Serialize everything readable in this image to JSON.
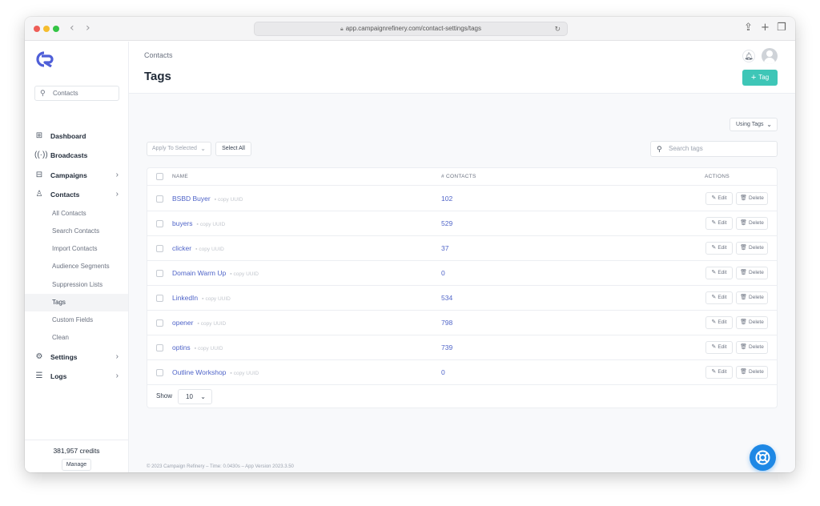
{
  "browser": {
    "url": "app.campaignrefinery.com/contact-settings/tags"
  },
  "sidebar": {
    "search_placeholder": "Contacts",
    "items": [
      {
        "label": "Dashboard",
        "icon": "grid-icon"
      },
      {
        "label": "Broadcasts",
        "icon": "broadcast-icon"
      },
      {
        "label": "Campaigns",
        "icon": "inbox-icon"
      },
      {
        "label": "Contacts",
        "icon": "user-icon"
      }
    ],
    "contacts_sub": [
      "All Contacts",
      "Search Contacts",
      "Import Contacts",
      "Audience Segments",
      "Suppression Lists",
      "Tags",
      "Custom Fields",
      "Clean"
    ],
    "active_sub": "Tags",
    "bottom_items": [
      {
        "label": "Settings",
        "icon": "gear-icon"
      },
      {
        "label": "Logs",
        "icon": "list-icon"
      }
    ],
    "credits": "381,957 credits",
    "manage_label": "Manage"
  },
  "header": {
    "breadcrumb": "Contacts",
    "title": "Tags",
    "add_tag_label": "Tag"
  },
  "toolbar": {
    "using_tags": "Using Tags",
    "apply_to_selected": "Apply To Selected",
    "select_all": "Select All",
    "search_placeholder": "Search tags"
  },
  "table": {
    "columns": [
      "NAME",
      "# CONTACTS",
      "ACTIONS"
    ],
    "copy_uuid_label": "copy UUID",
    "edit_label": "Edit",
    "delete_label": "Delete",
    "rows": [
      {
        "name": "BSBD Buyer",
        "count": "102"
      },
      {
        "name": "buyers",
        "count": "529"
      },
      {
        "name": "clicker",
        "count": "37"
      },
      {
        "name": "Domain Warm Up",
        "count": "0"
      },
      {
        "name": "LinkedIn",
        "count": "534"
      },
      {
        "name": "opener",
        "count": "798"
      },
      {
        "name": "optins",
        "count": "739"
      },
      {
        "name": "Outline Workshop",
        "count": "0"
      }
    ],
    "show_label": "Show",
    "show_value": "10"
  },
  "footer": {
    "text": "© 2023 Campaign Refinery – Time: 0.0430s – App Version 2023.3.50"
  },
  "colors": {
    "accent": "#3ec6b7",
    "link": "#4f64c8",
    "help": "#1e88e5"
  }
}
